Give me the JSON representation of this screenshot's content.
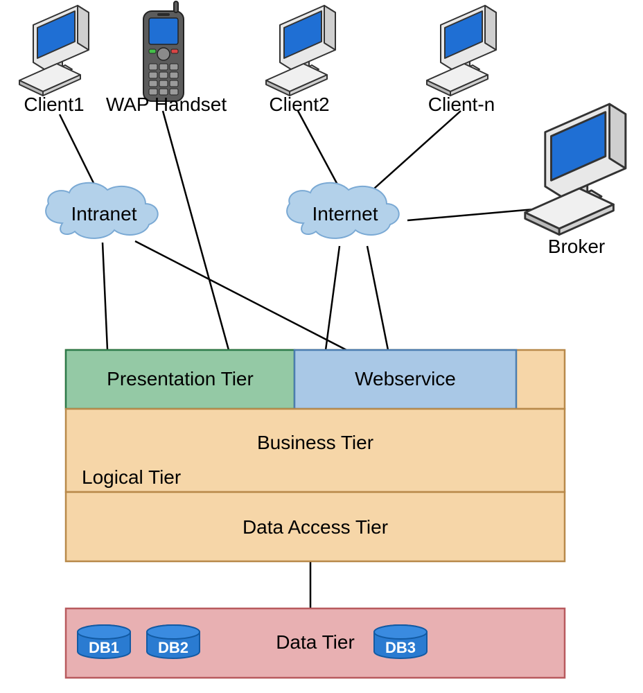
{
  "clients": {
    "client1": "Client1",
    "wap": "WAP Handset",
    "client2": "Client2",
    "clientn": "Client-n",
    "broker": "Broker"
  },
  "clouds": {
    "intranet": "Intranet",
    "internet": "Internet"
  },
  "tiers": {
    "presentation": "Presentation Tier",
    "webservice": "Webservice",
    "business": "Business Tier",
    "logical": "Logical Tier",
    "data_access": "Data Access Tier",
    "data": "Data Tier"
  },
  "dbs": {
    "db1": "DB1",
    "db2": "DB2",
    "db3": "DB3"
  },
  "colors": {
    "monitor_blue": "#1f6fd4",
    "cloud_fill": "#b3d1ea",
    "cloud_stroke": "#7aa9d4",
    "presentation_fill": "#94c9a5",
    "presentation_stroke": "#2d7a4a",
    "webservice_fill": "#a9c8e6",
    "webservice_stroke": "#4b7db0",
    "biz_fill": "#f6d6a8",
    "biz_stroke": "#b8894a",
    "data_tier_fill": "#e8b0b2",
    "data_tier_stroke": "#b85a5e",
    "db_fill": "#2a7bd1",
    "db_stroke": "#125aa3"
  }
}
